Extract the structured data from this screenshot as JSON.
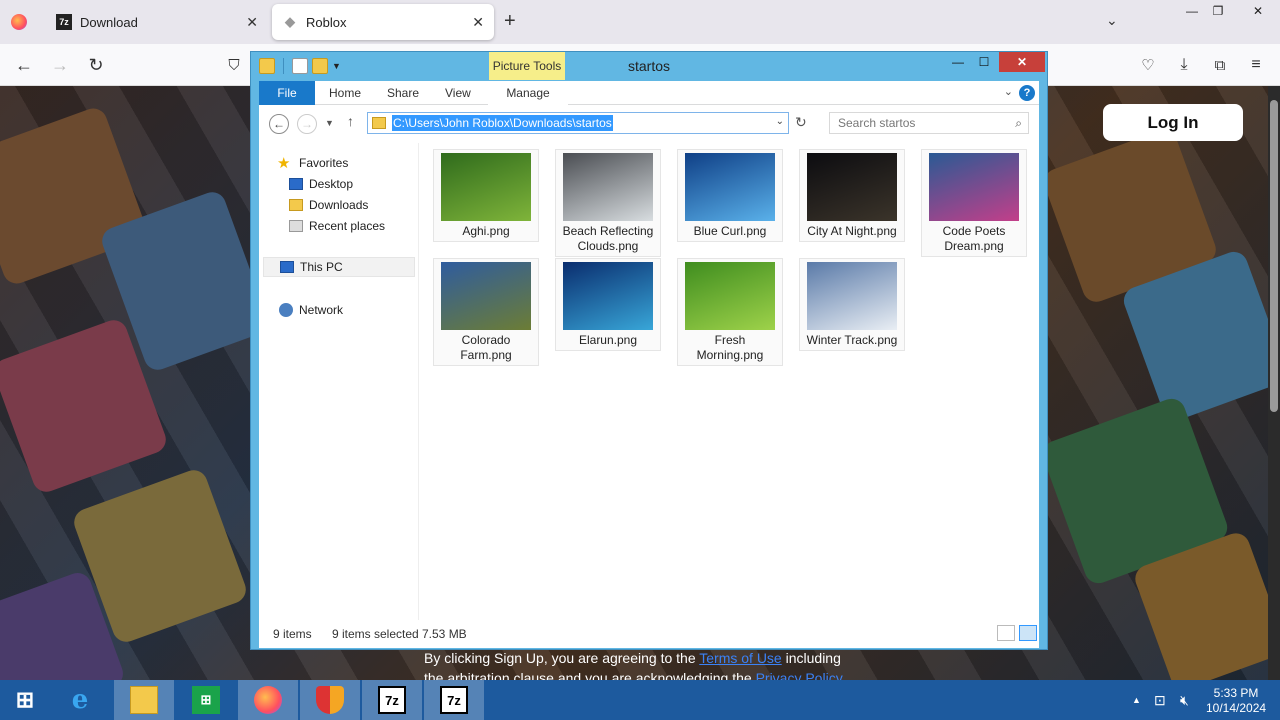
{
  "browser": {
    "tabs": [
      {
        "label": "Download",
        "active": false
      },
      {
        "label": "Roblox",
        "active": true
      }
    ]
  },
  "webpage": {
    "login_label": "Log In",
    "legal_prefix": "By clicking Sign Up, you are agreeing to the ",
    "terms_link": "Terms of Use",
    "legal_middle": " including the arbitration clause and you are acknowledging the ",
    "privacy_link": "Privacy Policy"
  },
  "explorer": {
    "title": "startos",
    "contextual_tab": "Picture Tools",
    "ribbon_tabs": [
      "File",
      "Home",
      "Share",
      "View",
      "Manage"
    ],
    "address": "C:\\Users\\John Roblox\\Downloads\\startos",
    "search_placeholder": "Search startos",
    "nav": {
      "favorites": "Favorites",
      "desktop": "Desktop",
      "downloads": "Downloads",
      "recent": "Recent places",
      "this_pc": "This PC",
      "network": "Network"
    },
    "files": [
      {
        "name": "Aghi.png",
        "colors": [
          "#2f6b1c",
          "#7fb43a"
        ]
      },
      {
        "name": "Beach Reflecting Clouds.png",
        "colors": [
          "#4a4d52",
          "#d8dde0"
        ]
      },
      {
        "name": "Blue Curl.png",
        "colors": [
          "#0f3f86",
          "#5ab1ea"
        ]
      },
      {
        "name": "City At Night.png",
        "colors": [
          "#0c0c10",
          "#3b342a"
        ]
      },
      {
        "name": "Code Poets Dream.png",
        "colors": [
          "#2a5a94",
          "#c33f8a"
        ]
      },
      {
        "name": "Colorado Farm.png",
        "colors": [
          "#2f5c9e",
          "#6c7d35"
        ]
      },
      {
        "name": "Elarun.png",
        "colors": [
          "#0a2d6e",
          "#38a6d8"
        ]
      },
      {
        "name": "Fresh Morning.png",
        "colors": [
          "#3f8d1f",
          "#9ed24a"
        ]
      },
      {
        "name": "Winter Track.png",
        "colors": [
          "#5a7aa8",
          "#e9eef4"
        ]
      }
    ],
    "status": {
      "count": "9 items",
      "selected": "9 items selected",
      "size": "7.53 MB"
    }
  },
  "taskbar": {
    "time": "5:33 PM",
    "date": "10/14/2024",
    "apps": [
      "start",
      "internet-explorer",
      "file-explorer",
      "store",
      "firefox",
      "security",
      "7zip",
      "7zip"
    ]
  }
}
